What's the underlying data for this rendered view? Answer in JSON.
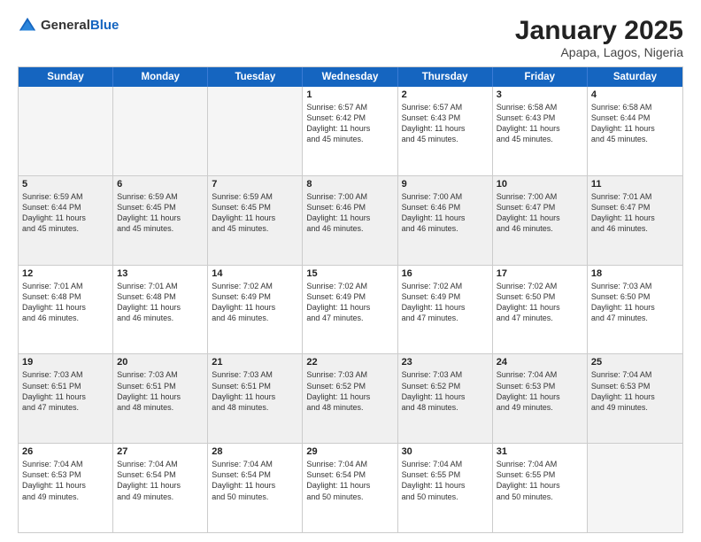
{
  "logo": {
    "text_general": "General",
    "text_blue": "Blue",
    "icon": "▶"
  },
  "title": "January 2025",
  "subtitle": "Apapa, Lagos, Nigeria",
  "header_days": [
    "Sunday",
    "Monday",
    "Tuesday",
    "Wednesday",
    "Thursday",
    "Friday",
    "Saturday"
  ],
  "rows": [
    [
      {
        "day": "",
        "info": "",
        "empty": true
      },
      {
        "day": "",
        "info": "",
        "empty": true
      },
      {
        "day": "",
        "info": "",
        "empty": true
      },
      {
        "day": "1",
        "info": "Sunrise: 6:57 AM\nSunset: 6:42 PM\nDaylight: 11 hours\nand 45 minutes."
      },
      {
        "day": "2",
        "info": "Sunrise: 6:57 AM\nSunset: 6:43 PM\nDaylight: 11 hours\nand 45 minutes."
      },
      {
        "day": "3",
        "info": "Sunrise: 6:58 AM\nSunset: 6:43 PM\nDaylight: 11 hours\nand 45 minutes."
      },
      {
        "day": "4",
        "info": "Sunrise: 6:58 AM\nSunset: 6:44 PM\nDaylight: 11 hours\nand 45 minutes."
      }
    ],
    [
      {
        "day": "5",
        "info": "Sunrise: 6:59 AM\nSunset: 6:44 PM\nDaylight: 11 hours\nand 45 minutes.",
        "shaded": true
      },
      {
        "day": "6",
        "info": "Sunrise: 6:59 AM\nSunset: 6:45 PM\nDaylight: 11 hours\nand 45 minutes.",
        "shaded": true
      },
      {
        "day": "7",
        "info": "Sunrise: 6:59 AM\nSunset: 6:45 PM\nDaylight: 11 hours\nand 45 minutes.",
        "shaded": true
      },
      {
        "day": "8",
        "info": "Sunrise: 7:00 AM\nSunset: 6:46 PM\nDaylight: 11 hours\nand 46 minutes.",
        "shaded": true
      },
      {
        "day": "9",
        "info": "Sunrise: 7:00 AM\nSunset: 6:46 PM\nDaylight: 11 hours\nand 46 minutes.",
        "shaded": true
      },
      {
        "day": "10",
        "info": "Sunrise: 7:00 AM\nSunset: 6:47 PM\nDaylight: 11 hours\nand 46 minutes.",
        "shaded": true
      },
      {
        "day": "11",
        "info": "Sunrise: 7:01 AM\nSunset: 6:47 PM\nDaylight: 11 hours\nand 46 minutes.",
        "shaded": true
      }
    ],
    [
      {
        "day": "12",
        "info": "Sunrise: 7:01 AM\nSunset: 6:48 PM\nDaylight: 11 hours\nand 46 minutes."
      },
      {
        "day": "13",
        "info": "Sunrise: 7:01 AM\nSunset: 6:48 PM\nDaylight: 11 hours\nand 46 minutes."
      },
      {
        "day": "14",
        "info": "Sunrise: 7:02 AM\nSunset: 6:49 PM\nDaylight: 11 hours\nand 46 minutes."
      },
      {
        "day": "15",
        "info": "Sunrise: 7:02 AM\nSunset: 6:49 PM\nDaylight: 11 hours\nand 47 minutes."
      },
      {
        "day": "16",
        "info": "Sunrise: 7:02 AM\nSunset: 6:49 PM\nDaylight: 11 hours\nand 47 minutes."
      },
      {
        "day": "17",
        "info": "Sunrise: 7:02 AM\nSunset: 6:50 PM\nDaylight: 11 hours\nand 47 minutes."
      },
      {
        "day": "18",
        "info": "Sunrise: 7:03 AM\nSunset: 6:50 PM\nDaylight: 11 hours\nand 47 minutes."
      }
    ],
    [
      {
        "day": "19",
        "info": "Sunrise: 7:03 AM\nSunset: 6:51 PM\nDaylight: 11 hours\nand 47 minutes.",
        "shaded": true
      },
      {
        "day": "20",
        "info": "Sunrise: 7:03 AM\nSunset: 6:51 PM\nDaylight: 11 hours\nand 48 minutes.",
        "shaded": true
      },
      {
        "day": "21",
        "info": "Sunrise: 7:03 AM\nSunset: 6:51 PM\nDaylight: 11 hours\nand 48 minutes.",
        "shaded": true
      },
      {
        "day": "22",
        "info": "Sunrise: 7:03 AM\nSunset: 6:52 PM\nDaylight: 11 hours\nand 48 minutes.",
        "shaded": true
      },
      {
        "day": "23",
        "info": "Sunrise: 7:03 AM\nSunset: 6:52 PM\nDaylight: 11 hours\nand 48 minutes.",
        "shaded": true
      },
      {
        "day": "24",
        "info": "Sunrise: 7:04 AM\nSunset: 6:53 PM\nDaylight: 11 hours\nand 49 minutes.",
        "shaded": true
      },
      {
        "day": "25",
        "info": "Sunrise: 7:04 AM\nSunset: 6:53 PM\nDaylight: 11 hours\nand 49 minutes.",
        "shaded": true
      }
    ],
    [
      {
        "day": "26",
        "info": "Sunrise: 7:04 AM\nSunset: 6:53 PM\nDaylight: 11 hours\nand 49 minutes."
      },
      {
        "day": "27",
        "info": "Sunrise: 7:04 AM\nSunset: 6:54 PM\nDaylight: 11 hours\nand 49 minutes."
      },
      {
        "day": "28",
        "info": "Sunrise: 7:04 AM\nSunset: 6:54 PM\nDaylight: 11 hours\nand 50 minutes."
      },
      {
        "day": "29",
        "info": "Sunrise: 7:04 AM\nSunset: 6:54 PM\nDaylight: 11 hours\nand 50 minutes."
      },
      {
        "day": "30",
        "info": "Sunrise: 7:04 AM\nSunset: 6:55 PM\nDaylight: 11 hours\nand 50 minutes."
      },
      {
        "day": "31",
        "info": "Sunrise: 7:04 AM\nSunset: 6:55 PM\nDaylight: 11 hours\nand 50 minutes."
      },
      {
        "day": "",
        "info": "",
        "empty": true
      }
    ]
  ]
}
